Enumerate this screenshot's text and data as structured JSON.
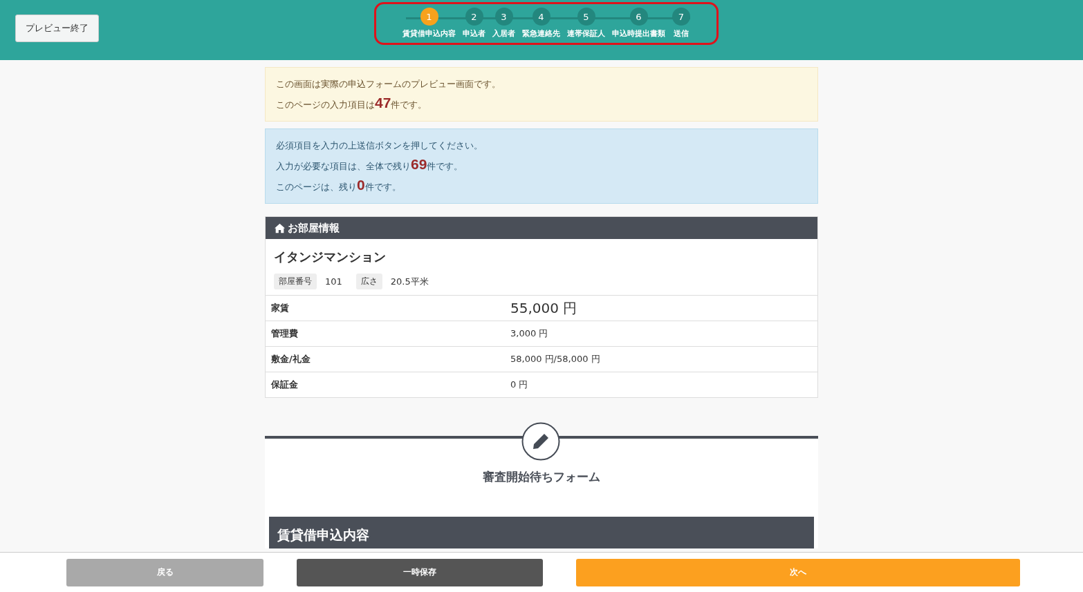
{
  "header": {
    "exit_button": "プレビュー終了",
    "stepper": {
      "highlighted": true,
      "steps": [
        {
          "number": "1",
          "label": "賃貸借申込内容",
          "selected": true
        },
        {
          "number": "2",
          "label": "申込者",
          "selected": false
        },
        {
          "number": "3",
          "label": "入居者",
          "selected": false
        },
        {
          "number": "4",
          "label": "緊急連絡先",
          "selected": false
        },
        {
          "number": "5",
          "label": "連帯保証人",
          "selected": false
        },
        {
          "number": "6",
          "label": "申込時提出書類",
          "selected": false
        },
        {
          "number": "7",
          "label": "送信",
          "selected": false
        }
      ]
    }
  },
  "preview_notice": {
    "lines": [
      "この画面は実際の申込フォームのプレビュー画面です。"
    ],
    "count_line": {
      "before": "このページの入力項目は",
      "count": "47",
      "after": "件です。"
    }
  },
  "required_notice": {
    "lines": [
      "必須項目を入力の上送信ボタンを押してください。"
    ],
    "count_lines": [
      {
        "before": "入力が必要な項目は、全体で残り",
        "count": "69",
        "after": "件です。"
      },
      {
        "before": "このページは、残り",
        "count": "0",
        "after": "件です。"
      }
    ]
  },
  "room_info": {
    "title": "お部屋情報",
    "building": "イタンジマンション",
    "tags": [
      {
        "label": "部屋番号",
        "value": "101"
      },
      {
        "label": "広さ",
        "value": "20.5平米"
      }
    ],
    "rows": [
      {
        "label": "家賃",
        "value": "55,000 円",
        "emphasis": true
      },
      {
        "label": "管理費",
        "value": "3,000 円",
        "emphasis": false
      },
      {
        "label": "敷金/礼金",
        "value": "58,000 円/58,000 円",
        "emphasis": false
      },
      {
        "label": "保証金",
        "value": "0 円",
        "emphasis": false
      }
    ]
  },
  "form": {
    "title": "審査開始待ちフォーム",
    "section_title": "賃貸借申込内容"
  },
  "footer": {
    "buttons": [
      {
        "label": "戻る",
        "kind": "back"
      },
      {
        "label": "一時保存",
        "kind": "save"
      },
      {
        "label": "次へ",
        "kind": "next"
      }
    ]
  }
}
